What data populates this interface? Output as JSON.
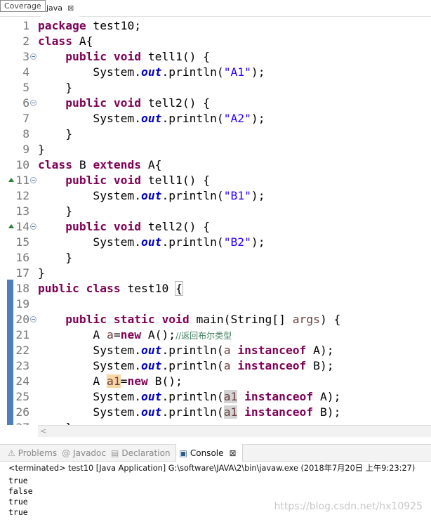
{
  "tooltip": "Coverage",
  "editor_tab": {
    "label": "java",
    "close": "⊠"
  },
  "code_lines": [
    {
      "n": "1",
      "marker": false,
      "fold": false,
      "tokens": [
        [
          "kw",
          "package"
        ],
        [
          "p",
          " test10;"
        ]
      ]
    },
    {
      "n": "2",
      "marker": false,
      "fold": false,
      "tokens": [
        [
          "kw",
          "class"
        ],
        [
          "p",
          " A{"
        ]
      ]
    },
    {
      "n": "3",
      "marker": false,
      "fold": true,
      "tokens": [
        [
          "p",
          "    "
        ],
        [
          "kw",
          "public void"
        ],
        [
          "p",
          " tell1() {"
        ]
      ]
    },
    {
      "n": "4",
      "marker": false,
      "fold": false,
      "tokens": [
        [
          "p",
          "        System."
        ],
        [
          "fld",
          "out"
        ],
        [
          "p",
          ".println("
        ],
        [
          "str",
          "\"A1\""
        ],
        [
          "p",
          ");"
        ]
      ]
    },
    {
      "n": "5",
      "marker": false,
      "fold": false,
      "tokens": [
        [
          "p",
          "    }"
        ]
      ]
    },
    {
      "n": "6",
      "marker": false,
      "fold": true,
      "tokens": [
        [
          "p",
          "    "
        ],
        [
          "kw",
          "public void"
        ],
        [
          "p",
          " tell2() {"
        ]
      ]
    },
    {
      "n": "7",
      "marker": false,
      "fold": false,
      "tokens": [
        [
          "p",
          "        System."
        ],
        [
          "fld",
          "out"
        ],
        [
          "p",
          ".println("
        ],
        [
          "str",
          "\"A2\""
        ],
        [
          "p",
          ");"
        ]
      ]
    },
    {
      "n": "8",
      "marker": false,
      "fold": false,
      "tokens": [
        [
          "p",
          "    }"
        ]
      ]
    },
    {
      "n": "9",
      "marker": false,
      "fold": false,
      "tokens": [
        [
          "p",
          "}"
        ]
      ]
    },
    {
      "n": "10",
      "marker": false,
      "fold": false,
      "tokens": [
        [
          "kw",
          "class"
        ],
        [
          "p",
          " B "
        ],
        [
          "kw",
          "extends"
        ],
        [
          "p",
          " A{"
        ]
      ]
    },
    {
      "n": "11",
      "marker": true,
      "fold": true,
      "tokens": [
        [
          "p",
          "    "
        ],
        [
          "kw",
          "public void"
        ],
        [
          "p",
          " tell1() {"
        ]
      ]
    },
    {
      "n": "12",
      "marker": false,
      "fold": false,
      "tokens": [
        [
          "p",
          "        System."
        ],
        [
          "fld",
          "out"
        ],
        [
          "p",
          ".println("
        ],
        [
          "str",
          "\"B1\""
        ],
        [
          "p",
          ");"
        ]
      ]
    },
    {
      "n": "13",
      "marker": false,
      "fold": false,
      "tokens": [
        [
          "p",
          "    }"
        ]
      ]
    },
    {
      "n": "14",
      "marker": true,
      "fold": true,
      "tokens": [
        [
          "p",
          "    "
        ],
        [
          "kw",
          "public void"
        ],
        [
          "p",
          " tell2() {"
        ]
      ]
    },
    {
      "n": "15",
      "marker": false,
      "fold": false,
      "tokens": [
        [
          "p",
          "        System."
        ],
        [
          "fld",
          "out"
        ],
        [
          "p",
          ".println("
        ],
        [
          "str",
          "\"B2\""
        ],
        [
          "p",
          ");"
        ]
      ]
    },
    {
      "n": "16",
      "marker": false,
      "fold": false,
      "tokens": [
        [
          "p",
          "    }"
        ]
      ]
    },
    {
      "n": "17",
      "marker": false,
      "fold": false,
      "tokens": [
        [
          "p",
          "}"
        ]
      ]
    },
    {
      "n": "18",
      "marker": false,
      "fold": false,
      "tokens": [
        [
          "kw",
          "public class"
        ],
        [
          "p",
          " test10 "
        ],
        [
          "box",
          "{"
        ]
      ]
    },
    {
      "n": "19",
      "marker": false,
      "fold": false,
      "tokens": []
    },
    {
      "n": "20",
      "marker": false,
      "fold": true,
      "tokens": [
        [
          "p",
          "    "
        ],
        [
          "kw",
          "public static void"
        ],
        [
          "p",
          " main(String[] "
        ],
        [
          "var",
          "args"
        ],
        [
          "p",
          ") {"
        ]
      ]
    },
    {
      "n": "21",
      "marker": false,
      "fold": false,
      "tokens": [
        [
          "p",
          "        A "
        ],
        [
          "var",
          "a"
        ],
        [
          "p",
          "="
        ],
        [
          "kw",
          "new"
        ],
        [
          "p",
          " A();"
        ],
        [
          "cmt",
          "//返回布尔类型"
        ]
      ]
    },
    {
      "n": "22",
      "marker": false,
      "fold": false,
      "tokens": [
        [
          "p",
          "        System."
        ],
        [
          "fld",
          "out"
        ],
        [
          "p",
          ".println("
        ],
        [
          "var",
          "a"
        ],
        [
          "p",
          " "
        ],
        [
          "kw",
          "instanceof"
        ],
        [
          "p",
          " A);"
        ]
      ]
    },
    {
      "n": "23",
      "marker": false,
      "fold": false,
      "tokens": [
        [
          "p",
          "        System."
        ],
        [
          "fld",
          "out"
        ],
        [
          "p",
          ".println("
        ],
        [
          "var",
          "a"
        ],
        [
          "p",
          " "
        ],
        [
          "kw",
          "instanceof"
        ],
        [
          "p",
          " B);"
        ]
      ]
    },
    {
      "n": "24",
      "marker": false,
      "fold": false,
      "tokens": [
        [
          "p",
          "        A "
        ],
        [
          "hlw",
          "a1"
        ],
        [
          "p",
          "="
        ],
        [
          "kw",
          "new"
        ],
        [
          "p",
          " B();"
        ]
      ]
    },
    {
      "n": "25",
      "marker": false,
      "fold": false,
      "tokens": [
        [
          "p",
          "        System."
        ],
        [
          "fld",
          "out"
        ],
        [
          "p",
          ".println("
        ],
        [
          "hl",
          "a1"
        ],
        [
          "p",
          " "
        ],
        [
          "kw",
          "instanceof"
        ],
        [
          "p",
          " A);"
        ]
      ]
    },
    {
      "n": "26",
      "marker": false,
      "fold": false,
      "tokens": [
        [
          "p",
          "        System."
        ],
        [
          "fld",
          "out"
        ],
        [
          "p",
          ".println("
        ],
        [
          "hl",
          "a1"
        ],
        [
          "p",
          " "
        ],
        [
          "kw",
          "instanceof"
        ],
        [
          "p",
          " B);"
        ]
      ]
    },
    {
      "n": "27",
      "marker": false,
      "fold": false,
      "tokens": [
        [
          "p",
          "    }"
        ]
      ]
    }
  ],
  "scroll_arrow": "<",
  "view_tabs": [
    {
      "name": "tab-problems",
      "icon": "⚠",
      "icon_name": "problems-icon",
      "label": "Problems",
      "active": false
    },
    {
      "name": "tab-javadoc",
      "icon": "@",
      "icon_name": "javadoc-icon",
      "label": "Javadoc",
      "active": false
    },
    {
      "name": "tab-declaration",
      "icon": "▤",
      "icon_name": "declaration-icon",
      "label": "Declaration",
      "active": false
    },
    {
      "name": "tab-console",
      "icon": "▣",
      "icon_name": "console-icon",
      "label": "Console",
      "active": true,
      "close": "⊠"
    }
  ],
  "console": {
    "header": "<terminated> test10 [Java Application] G:\\software\\JAVA\\2\\bin\\javaw.exe (2018年7月20日 上午9:23:27)",
    "lines": [
      "true",
      "false",
      "true",
      "true"
    ],
    "watermark": "https://blog.csdn.net/hx10925"
  },
  "colors": {
    "keyword": "#7f0055",
    "static_field": "#0000c0",
    "string": "#2a00ff",
    "comment": "#3f7f5f",
    "local_var": "#6a3e3e",
    "change_bar": "#4d7fb8"
  }
}
